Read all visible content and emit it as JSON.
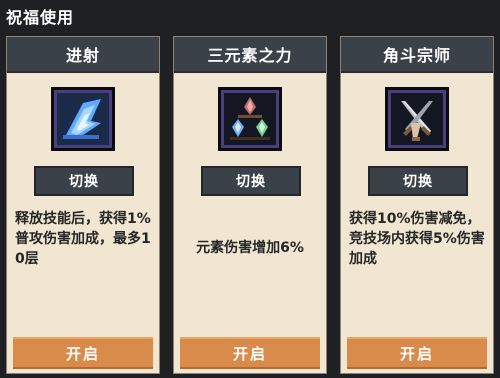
{
  "page": {
    "title": "祝福使用"
  },
  "cards": [
    {
      "name": "进射",
      "icon": "blue-wing-icon",
      "switch_label": "切换",
      "description": "释放技能后，获得1%普攻伤害加成，最多10层",
      "open_label": "开启"
    },
    {
      "name": "三元素之力",
      "icon": "elemental-gems-icon",
      "switch_label": "切换",
      "description": "元素伤害增加6%",
      "open_label": "开启"
    },
    {
      "name": "角斗宗师",
      "icon": "crossed-swords-icon",
      "switch_label": "切换",
      "description": "获得10%伤害减免，竞技场内获得5%伤害加成",
      "open_label": "开启"
    }
  ]
}
